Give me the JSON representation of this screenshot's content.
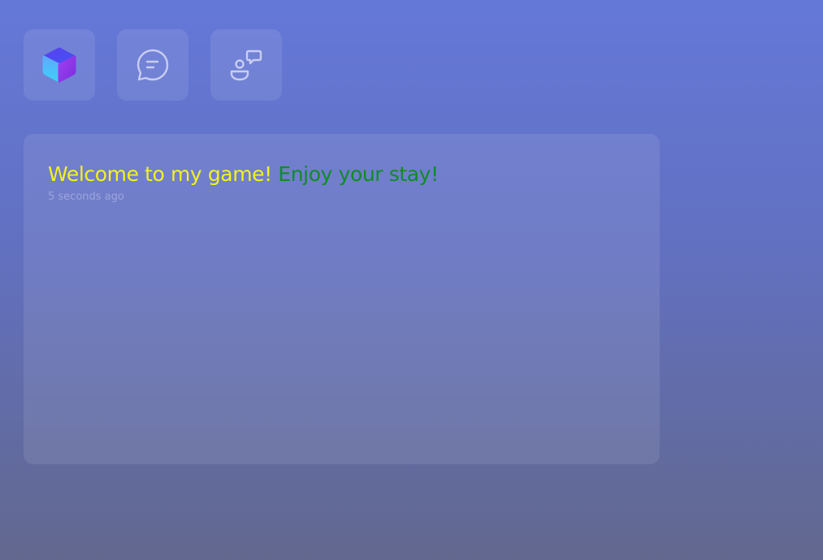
{
  "toolbar": {
    "items": [
      {
        "icon": "cube-logo-icon",
        "colors": [
          "#7b3fe4",
          "#4fc3f7",
          "#3f51f5"
        ]
      },
      {
        "icon": "chat-bubble-icon"
      },
      {
        "icon": "user-speech-icon"
      }
    ]
  },
  "chat": {
    "messages": [
      {
        "segments": [
          {
            "text": "Welcome to my game! ",
            "color": "#f2f21f"
          },
          {
            "text": "Enjoy your stay!",
            "color": "#0f8c26"
          }
        ],
        "timestamp": "5 seconds ago"
      }
    ]
  }
}
